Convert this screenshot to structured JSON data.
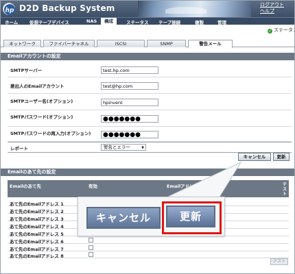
{
  "header": {
    "title": "D2D Backup System",
    "logout_line1": "ログアウト",
    "logout_line2": "ヘルプ",
    "brand_color": "#3d4e67"
  },
  "menu": {
    "items": [
      "ホーム",
      "仮想テープデバイス",
      "NAS",
      "構成",
      "ステータス",
      "テープ接続",
      "複製",
      "管理"
    ],
    "active_index": 3
  },
  "status": {
    "text": "ステータス",
    "icon": "check-icon",
    "color": "#3a9a3a"
  },
  "subtabs": {
    "items": [
      "ネットワーク",
      "ファイバーチャネル",
      "iSCSI",
      "SNMP",
      "警告メール"
    ],
    "active_index": 4
  },
  "email_settings": {
    "section_title": "Emailアカウントの設定",
    "fields": [
      {
        "label": "SMTPサーバー",
        "value": "test.hp.com"
      },
      {
        "label": "差出人のEmailアカウント",
        "value": "test@hp.com"
      },
      {
        "label": "SMTPユーザー名(オプション)",
        "value": "hpinvent"
      },
      {
        "label": "SMTPパスワード(オプション)",
        "value": "●●●●●●●"
      },
      {
        "label": "SMTPパスワードの再入力(オプション)",
        "value": "●●●●●●●"
      }
    ],
    "report_label": "レポート",
    "report_value": "警告とエラー",
    "cancel_label": "キャンセル",
    "update_label": "更新"
  },
  "recipients": {
    "section_title": "Emailのあて先の設定",
    "columns": [
      "Emailのあて先",
      "有効",
      "Emailアドレス",
      "テスト"
    ],
    "rows": [
      "あて先のEmailアドレス 1",
      "あて先のEmailアドレス 2",
      "あて先のEmailアドレス 3",
      "あて先のEmailアドレス 4",
      "あて先のEmailアドレス 5",
      "あて先のEmailアドレス 6",
      "あて先のEmailアドレス 7",
      "あて先のEmailアドレス 8"
    ],
    "test_button_label": "テスト"
  },
  "callout": {
    "cancel_label": "キャンセル",
    "update_label": "更新",
    "highlight_color": "#e01414"
  }
}
